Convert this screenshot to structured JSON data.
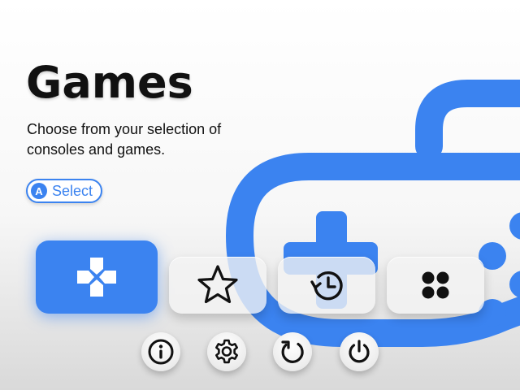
{
  "header": {
    "title": "Games",
    "subtitle": "Choose from your selection of consoles and games."
  },
  "hint": {
    "button_glyph": "A",
    "label": "Select"
  },
  "tiles": [
    {
      "name": "games",
      "icon": "dpad-icon",
      "active": true
    },
    {
      "name": "favorites",
      "icon": "star-icon",
      "active": false
    },
    {
      "name": "recent",
      "icon": "history-icon",
      "active": false
    },
    {
      "name": "apps",
      "icon": "grid-icon",
      "active": false
    }
  ],
  "system_buttons": [
    {
      "name": "info",
      "icon": "info-icon"
    },
    {
      "name": "settings",
      "icon": "gear-icon"
    },
    {
      "name": "restart",
      "icon": "refresh-icon"
    },
    {
      "name": "power",
      "icon": "power-icon"
    }
  ],
  "colors": {
    "accent": "#3b83f0",
    "background_top": "#ffffff",
    "background_bottom": "#d9d9d9",
    "text": "#111111"
  }
}
